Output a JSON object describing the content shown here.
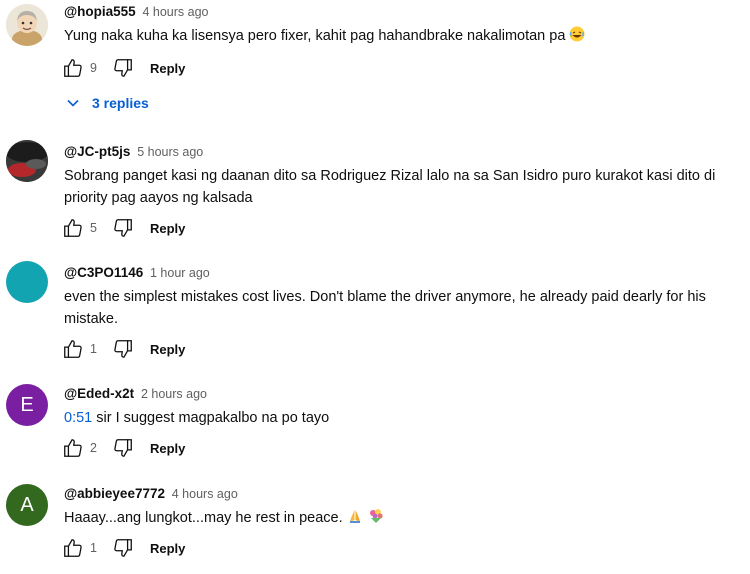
{
  "comments": [
    {
      "author": "@hopia555",
      "time": "4 hours ago",
      "text": "Yung naka kuha ka lisensya pero fixer, kahit pag hahandbrake nakalimotan pa",
      "likes": "9",
      "reply_label": "Reply",
      "avatar_icon": "cartoon-face-avatar"
    },
    {
      "author": "@JC-pt5js",
      "time": "5 hours ago",
      "text": "Sobrang panget kasi ng daanan dito sa Rodriguez Rizal lalo na sa San Isidro puro kurakot kasi dito di priority pag aayos ng kalsada",
      "likes": "5",
      "reply_label": "Reply",
      "avatar_icon": "dark-photo-avatar"
    },
    {
      "author": "@C3PO1146",
      "time": "1 hour ago",
      "text": "even the simplest mistakes cost lives. Don't blame the driver anymore, he already paid dearly for his mistake.",
      "likes": "1",
      "reply_label": "Reply",
      "avatar_color": "#12a4b0"
    },
    {
      "author": "@Eded-x2t",
      "time": "2 hours ago",
      "timestamp_link": "0:51",
      "text": " sir I suggest magpakalbo na po tayo",
      "likes": "2",
      "reply_label": "Reply",
      "avatar_letter": "E",
      "avatar_color": "#7b1fa2"
    },
    {
      "author": "@abbieyee7772",
      "time": "4 hours ago",
      "text": "Haaay...ang lungkot...may he rest in peace.",
      "likes": "1",
      "reply_label": "Reply",
      "avatar_letter": "A",
      "avatar_color": "#33691e"
    }
  ],
  "replies_toggle": {
    "label": "3 replies"
  },
  "colors": {
    "link": "#065fd4",
    "meta": "#606060",
    "text": "#0f0f0f"
  }
}
